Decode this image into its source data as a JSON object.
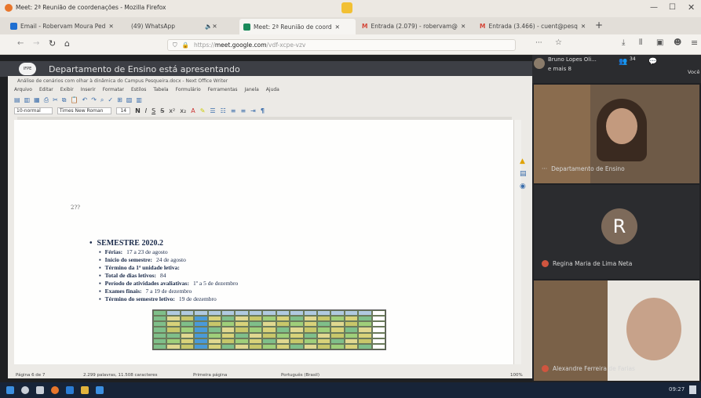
{
  "window": {
    "title": "Meet: 2ª Reunião de coordenações - Mozilla Firefox"
  },
  "tabs": [
    {
      "label": "Email - Robervam Moura Ped",
      "icon": "email-icon",
      "active": false
    },
    {
      "label": "(49) WhatsApp",
      "icon": "whatsapp-icon",
      "active": false
    },
    {
      "label": "Meet: 2ª Reunião de coord",
      "icon": "meet-icon",
      "active": true
    },
    {
      "label": "Entrada (2.079) - robervam@",
      "icon": "gmail-icon",
      "active": false
    },
    {
      "label": "Entrada (3.466) - cuent@pesq",
      "icon": "gmail-icon",
      "active": false
    }
  ],
  "nav": {
    "url_prefix": "https://",
    "url_domain": "meet.google.com",
    "url_path": "/vdf-xcpe-vzv"
  },
  "meet": {
    "presenter_banner": "Departamento de Ensino está apresentando",
    "participants_top": "Bruno Lopes Oli...",
    "participants_more": "e mais 8",
    "count_badge": "34",
    "you_label": "Você",
    "tiles": [
      {
        "name": "Departamento de Ensino"
      },
      {
        "name": "Regina Maria de Lima Neta",
        "initial": "R"
      },
      {
        "name": "Alexandre Ferreira de Farias"
      }
    ]
  },
  "writer": {
    "title": "Análise de cenários com olhar à dinâmica do Campus Pesqueira.docx - Next Office Writer",
    "menu": [
      "Arquivo",
      "Editar",
      "Exibir",
      "Inserir",
      "Formatar",
      "Estilos",
      "Tabela",
      "Formulário",
      "Ferramentas",
      "Janela",
      "Ajuda"
    ],
    "style_box": "10-normal",
    "font_box": "Times New Roman",
    "size_box": "14",
    "page_label": "2??",
    "semester": "SEMESTRE 2020.2",
    "items": [
      {
        "label": "Férias:",
        "value": "17 a 23 de agosto"
      },
      {
        "label": "Início do semestre:",
        "value": "24 de agosto"
      },
      {
        "label": "Término da 1ª unidade letiva:",
        "value": ""
      },
      {
        "label": "Total de dias letivos:",
        "value": "84"
      },
      {
        "label": "Período de atividades avaliativas:",
        "value": "1º a 5 de dezembro"
      },
      {
        "label": "Exames finais:",
        "value": "7 a 19 de dezembro"
      },
      {
        "label": "Término do semestre letivo:",
        "value": "19 de dezembro"
      }
    ],
    "status": {
      "page": "Página 6 de 7",
      "words": "2.299 palavras, 11.508 caracteres",
      "style": "Primeira página",
      "lang": "Português (Brasil)",
      "zoom": "100%"
    }
  },
  "taskbar": {
    "time": "09:27"
  },
  "colors": {
    "banner": "#3d3f45",
    "mic": "#d0553f",
    "taskbar": "#172438"
  }
}
